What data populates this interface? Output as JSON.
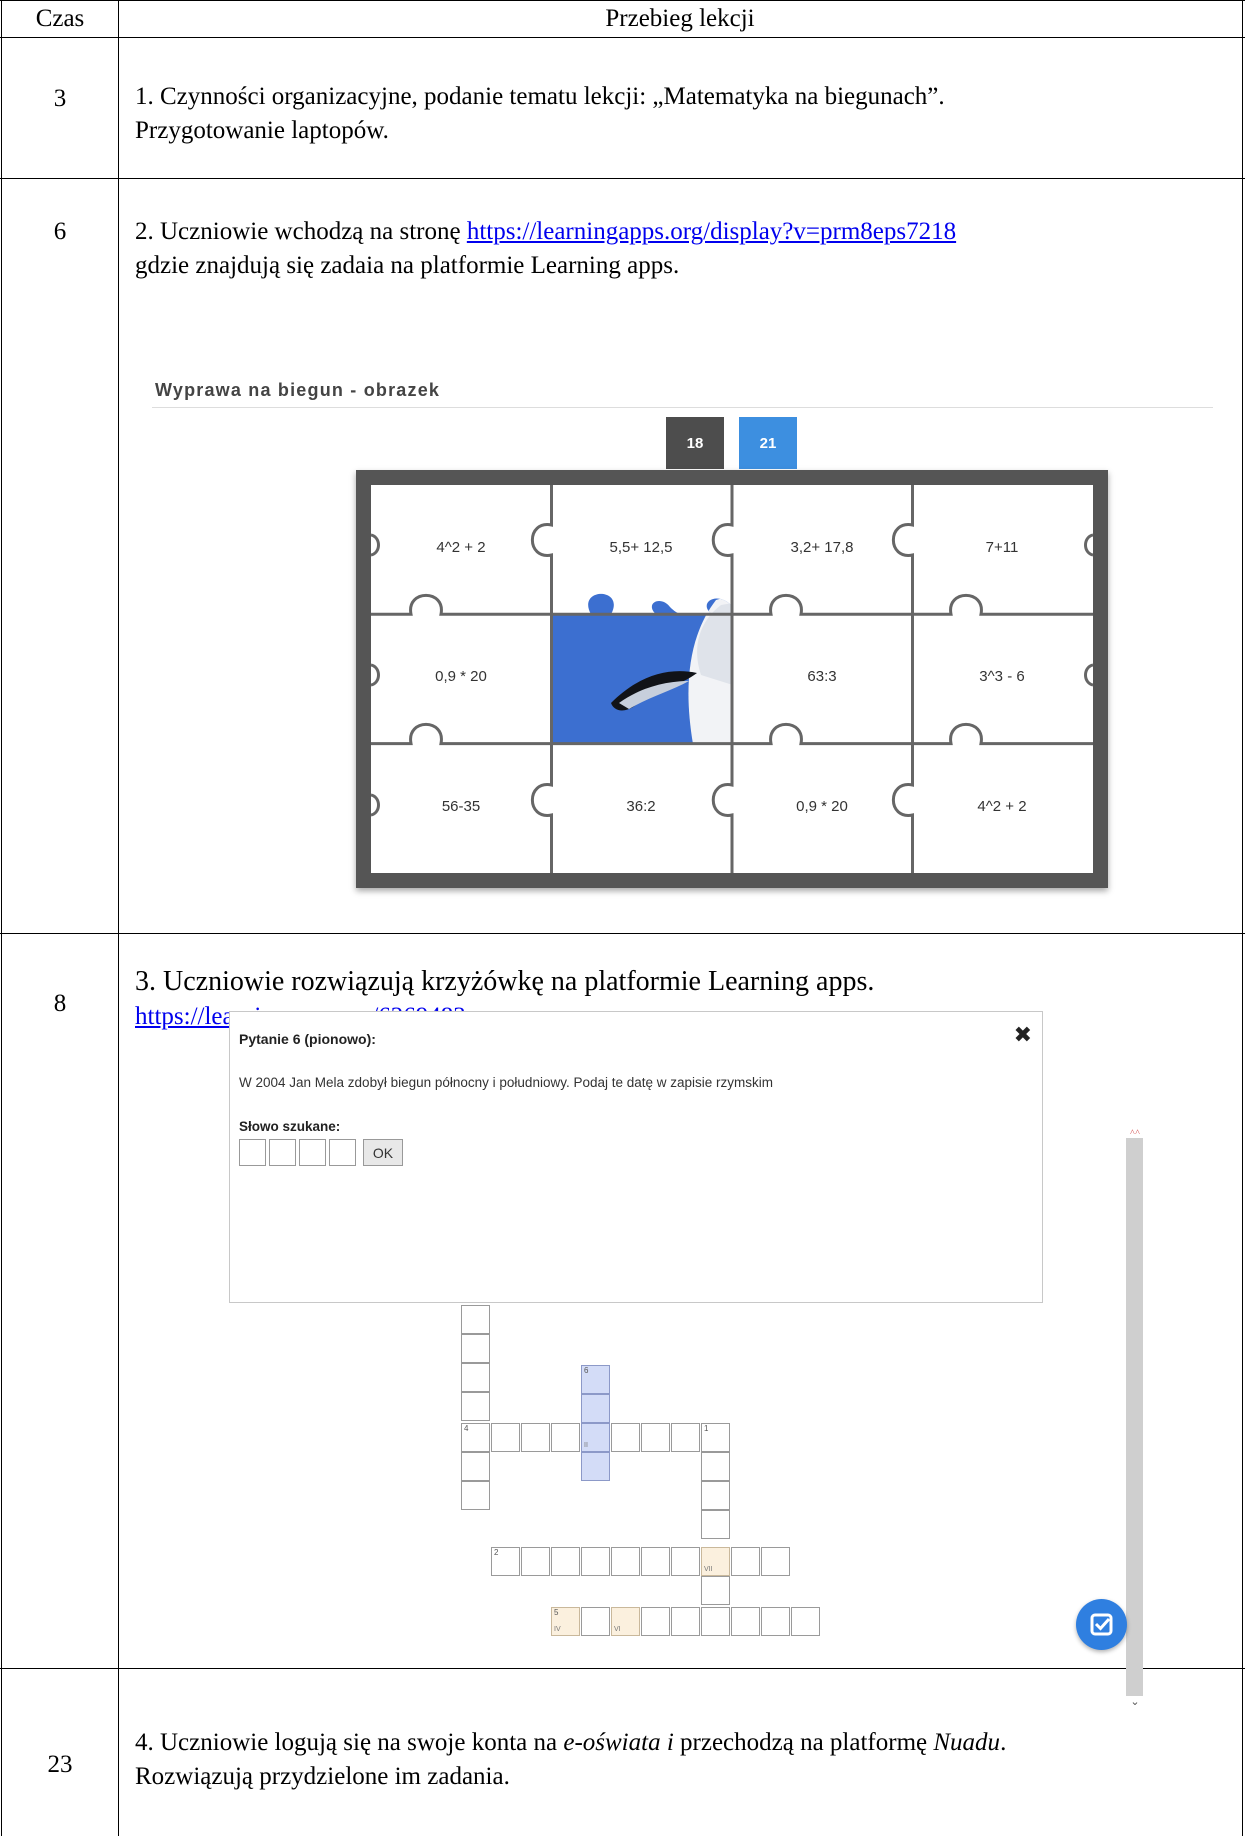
{
  "table": {
    "header_time": "Czas",
    "header_content": "Przebieg lekcji"
  },
  "rows": [
    {
      "time": "3",
      "line1": "1. Czynności organizacyjne, podanie tematu lekcji: „Matematyka na biegunach”.",
      "line2": "Przygotowanie laptopów."
    },
    {
      "time": "6",
      "line1_prefix": "2. Uczniowie wchodzą na stronę ",
      "line1_link": "https://learningapps.org/display?v=prm8eps7218",
      "line2": " gdzie znajdują się zadaia na platformie Learning apps."
    },
    {
      "time": "8",
      "line1": "3. Uczniowie rozwiązują krzyżówkę na platformie Learning apps.",
      "link": "https://learningapps.org/6269483"
    },
    {
      "time": "23",
      "line1_a": "4. Uczniowie logują się na swoje konta na ",
      "line1_b": "e-oświata i",
      "line1_c": " przechodzą na platformę ",
      "line1_d": "Nuadu",
      "line1_e": ".",
      "line2": "Rozwiązują przydzielone im zadania."
    }
  ],
  "puzzle_app": {
    "title": "Wyprawa na biegun - obrazek",
    "tabs": [
      {
        "label": "18",
        "color": "#4d4d4d"
      },
      {
        "label": "21",
        "color": "#3d8fe0"
      }
    ],
    "pieces": [
      [
        "4^2 + 2",
        "5,5+ 12,5",
        "3,2+ 17,8",
        "7+11"
      ],
      [
        "0,9 * 20",
        "",
        "63:3",
        "3^3 - 6"
      ],
      [
        "56-35",
        "36:2",
        "0,9 * 20",
        "4^2 + 2"
      ]
    ],
    "colors": {
      "frame": "#555555",
      "sky": "#3c6fd0"
    }
  },
  "crossword_app": {
    "dialog_title": "Pytanie 6 (pionowo):",
    "question": "W 2004 Jan Mela zdobył biegun północny i południowy. Podaj te datę w zapisie rzymskim",
    "answer_label": "Słowo szukane:",
    "ok_label": "OK",
    "clue_numbers": {
      "n1": "1",
      "n2": "2",
      "n4": "4",
      "n5": "5",
      "n6": "6"
    },
    "cell_marks": {
      "ii": "II",
      "iv": "IV",
      "vi": "VI",
      "vii": "VII"
    },
    "icons": [
      "close-icon",
      "check-icon"
    ]
  }
}
